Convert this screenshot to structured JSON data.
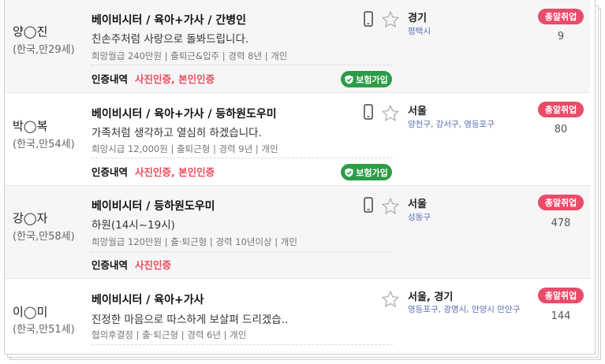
{
  "colors": {
    "cert_accent": "#ee4b5b",
    "insurance_green": "#2e9c47",
    "jobs_pink": "#e94c6b",
    "region_blue": "#5a6fb0"
  },
  "rows": [
    {
      "name": "양◯진",
      "age": "(한국,만29세)",
      "title": "베이비시터 / 육아+가사 / 간병인",
      "desc": "친손주처럼 사랑으로 돌봐드립니다.",
      "meta": "희망월급 240만원 | 출퇴근&입주 | 경력 8년 | 개인",
      "cert_label": "인증내역",
      "cert_value": "사진인증, 본인인증",
      "insurance": "보험가입",
      "region": "경기",
      "sub_region": "평택시",
      "jobs_badge": "총알취업",
      "count": "9"
    },
    {
      "name": "박◯복",
      "age": "(한국,만54세)",
      "title": "베이비시터 / 육아+가사 / 등하원도우미",
      "desc": "가족처럼 생각하고 열심히 하겠습니다.",
      "meta": "희망시급 12,000원 | 출퇴근형 | 경력 9년 | 개인",
      "cert_label": "인증내역",
      "cert_value": "사진인증, 본인인증",
      "insurance": "보험가입",
      "region": "서울",
      "sub_region": "양천구, 강서구, 영등포구",
      "jobs_badge": "총알취업",
      "count": "80"
    },
    {
      "name": "강◯자",
      "age": "(한국,만58세)",
      "title": "베이비시터 / 등하원도우미",
      "desc": "하원(14시~19시)",
      "meta": "희망월급 120만원 | 출·퇴근형 | 경력 10년이상 | 개인",
      "cert_label": "인증내역",
      "cert_value": "사진인증",
      "region": "서울",
      "sub_region": "성동구",
      "jobs_badge": "총알취업",
      "count": "478"
    },
    {
      "name": "이◯미",
      "age": "(한국,만51세)",
      "title": "베이비시터 / 육아+가사",
      "desc": "진정한 마음으로 따스하게 보살펴 드리겠습..",
      "meta": "협의후결정 | 출·퇴근형 | 경력 6년 | 개인",
      "region": "서울, 경기",
      "sub_region": "영등포구, 광명시, 안양시 만안구",
      "jobs_badge": "총알취업",
      "count": "144"
    }
  ]
}
